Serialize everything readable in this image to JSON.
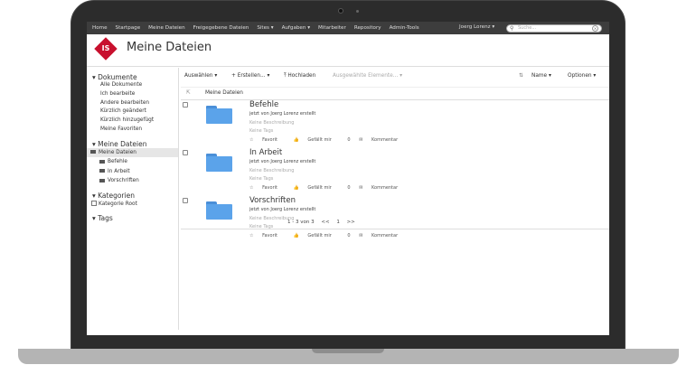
{
  "nav": {
    "home": "Home",
    "startpage": "Startpage",
    "my_files": "Meine Dateien",
    "shared_files": "Freigegebene Dateien",
    "sites": "Sites ▾",
    "tasks": "Aufgaben ▾",
    "people": "Mitarbeiter",
    "repository": "Repository",
    "admin": "Admin-Tools",
    "user": "Joerg Lorenz ▾",
    "search_placeholder": "Suche..."
  },
  "header": {
    "logo_text": "IS",
    "title": "Meine Dateien"
  },
  "sidebar": {
    "documents_title": "▾ Dokumente",
    "documents": [
      "Alle Dokumente",
      "Ich bearbeite",
      "Andere bearbeiten",
      "Kürzlich geändert",
      "Kürzlich hinzugefügt",
      "Meine Favoriten"
    ],
    "myfiles_title": "▾ Meine Dateien",
    "myfiles_root": "Meine Dateien",
    "folders": [
      "Befehle",
      "In Arbeit",
      "Vorschriften"
    ],
    "categories_title": "▾ Kategorien",
    "category_root": "Kategorie Root",
    "tags_title": "▾ Tags"
  },
  "toolbar": {
    "select": "Auswählen ▾",
    "create": "+ Erstellen... ▾",
    "upload": "Hochladen",
    "selected": "Ausgewählte Elemente... ▾",
    "sort": "Name ▾",
    "options": "Optionen ▾"
  },
  "breadcrumb": {
    "current": "Meine Dateien"
  },
  "items": [
    {
      "name": "Befehle",
      "meta": "jetzt von Joerg Lorenz erstellt",
      "desc": "Keine Beschreibung",
      "tags": "Keine Tags",
      "fav": "Favorit",
      "like": "Gefällt mir",
      "likes": "0",
      "comment": "Kommentar"
    },
    {
      "name": "In Arbeit",
      "meta": "jetzt von Joerg Lorenz erstellt",
      "desc": "Keine Beschreibung",
      "tags": "Keine Tags",
      "fav": "Favorit",
      "like": "Gefällt mir",
      "likes": "0",
      "comment": "Kommentar"
    },
    {
      "name": "Vorschriften",
      "meta": "jetzt von Joerg Lorenz erstellt",
      "desc": "Keine Beschreibung",
      "tags": "Keine Tags",
      "fav": "Favorit",
      "like": "Gefällt mir",
      "likes": "0",
      "comment": "Kommentar"
    }
  ],
  "pager": {
    "range": "1 - 3 von 3",
    "prev": "<<",
    "page": "1",
    "next": ">>"
  },
  "colors": {
    "brand": "#c8102e",
    "folder": "#5ba3ea",
    "nav_bg": "#3d3d3d"
  }
}
